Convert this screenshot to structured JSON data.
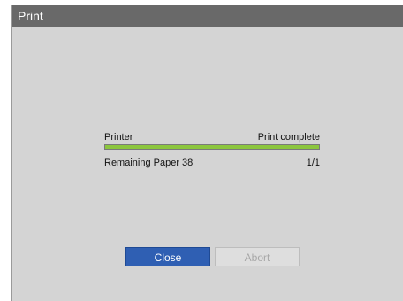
{
  "window": {
    "title": "Print"
  },
  "status": {
    "device_label": "Printer",
    "state_text": "Print complete",
    "progress_percent": 100
  },
  "info": {
    "remaining_paper_label": "Remaining Paper 38",
    "page_counter": "1/1"
  },
  "buttons": {
    "close_label": "Close",
    "abort_label": "Abort"
  },
  "colors": {
    "titlebar": "#696969",
    "dialog_background": "#d4d4d4",
    "progress_fill": "#8cc63e",
    "primary_button": "#2f5fb3"
  }
}
